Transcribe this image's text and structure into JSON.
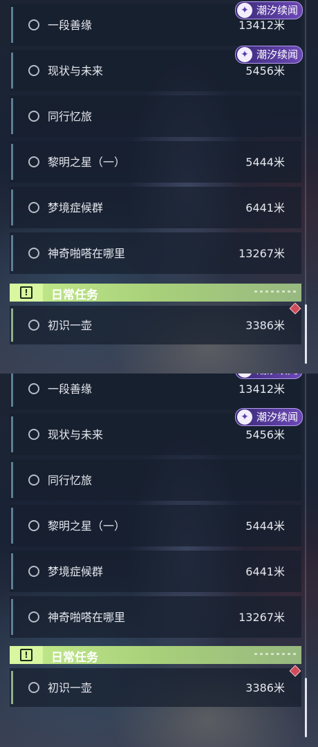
{
  "tracker": {
    "quests": [
      {
        "name": "一段善缘",
        "distance": "13412米"
      },
      {
        "name": "现状与未来",
        "distance": "5456米"
      },
      {
        "name": "同行忆旅",
        "distance": ""
      },
      {
        "name": "黎明之星（一）",
        "distance": "5444米"
      },
      {
        "name": "梦境症候群",
        "distance": "6441米"
      },
      {
        "name": "神奇啪嗒在哪里",
        "distance": "13267米"
      }
    ],
    "badge_label": "潮汐续闻",
    "badge_icon": "tidal-quest-icon",
    "daily_section_title": "日常任务",
    "daily_section_icon": "exclamation-icon",
    "daily_quests": [
      {
        "name": "初识一壶",
        "distance": "3386米"
      }
    ],
    "colors": {
      "badge": "#6c48b6",
      "section": "#c4ec8c",
      "alert_marker": "#d04b5a"
    }
  }
}
